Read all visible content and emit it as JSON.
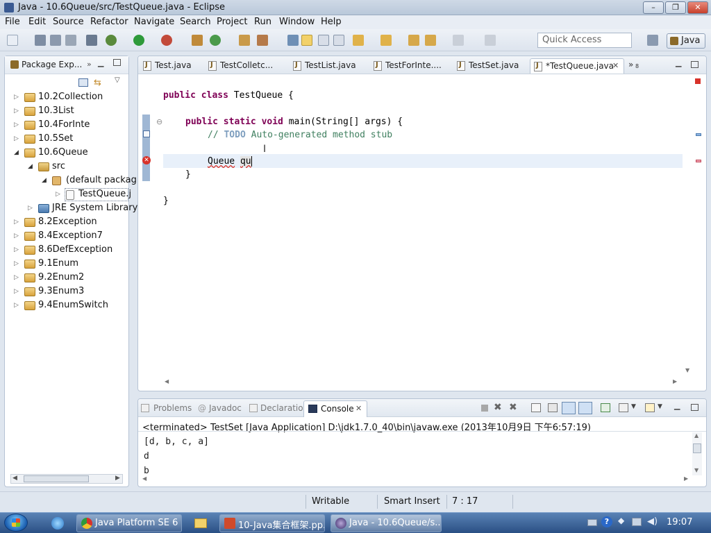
{
  "window": {
    "title": "Java - 10.6Queue/src/TestQueue.java - Eclipse"
  },
  "menu": [
    "File",
    "Edit",
    "Source",
    "Refactor",
    "Navigate",
    "Search",
    "Project",
    "Run",
    "Window",
    "Help"
  ],
  "toolbar": {
    "quick_access_placeholder": "Quick Access",
    "perspective": "Java"
  },
  "package_explorer": {
    "title": "Package Exp...",
    "items": [
      {
        "label": "10.2Collection"
      },
      {
        "label": "10.3List"
      },
      {
        "label": "10.4ForInte"
      },
      {
        "label": "10.5Set"
      },
      {
        "label": "10.6Queue"
      },
      {
        "label": "src"
      },
      {
        "label": "(default packag"
      },
      {
        "label": "TestQueue.j"
      },
      {
        "label": "JRE System Library"
      },
      {
        "label": "8.2Exception"
      },
      {
        "label": "8.4Exception7"
      },
      {
        "label": "8.6DefException"
      },
      {
        "label": "9.1Enum"
      },
      {
        "label": "9.2Enum2"
      },
      {
        "label": "9.3Enum3"
      },
      {
        "label": "9.4EnumSwitch"
      }
    ]
  },
  "editor": {
    "tabs": [
      "Test.java",
      "TestColletc...",
      "TestList.java",
      "TestForInte....",
      "TestSet.java",
      "*TestQueue.java"
    ],
    "overflow": "8",
    "code": {
      "l1_kw": "public class",
      "l1_rest": " TestQueue {",
      "l2_kw": "public static void",
      "l2_rest": " main(String[] args) {",
      "l3_prefix": "// ",
      "l3_todo": "TODO",
      "l3_rest": " Auto-generated method stub",
      "l4_type": "Queue",
      "l4_var": "qu",
      "l5": "}",
      "l6": "}"
    }
  },
  "console": {
    "tabs": [
      "Problems",
      "Javadoc",
      "Declaration",
      "Console"
    ],
    "header": "<terminated> TestSet [Java Application] D:\\jdk1.7.0_40\\bin\\javaw.exe (2013年10月9日 下午6:57:19)",
    "lines": [
      "[d, b, c, a]",
      "d",
      "b"
    ]
  },
  "status": {
    "writable": "Writable",
    "insert_mode": "Smart Insert",
    "position": "7 : 17"
  },
  "taskbar": {
    "items": [
      "Java Platform SE 6 ...",
      "10-Java集合框架.pp...",
      "Java - 10.6Queue/s..."
    ],
    "clock": "19:07"
  }
}
